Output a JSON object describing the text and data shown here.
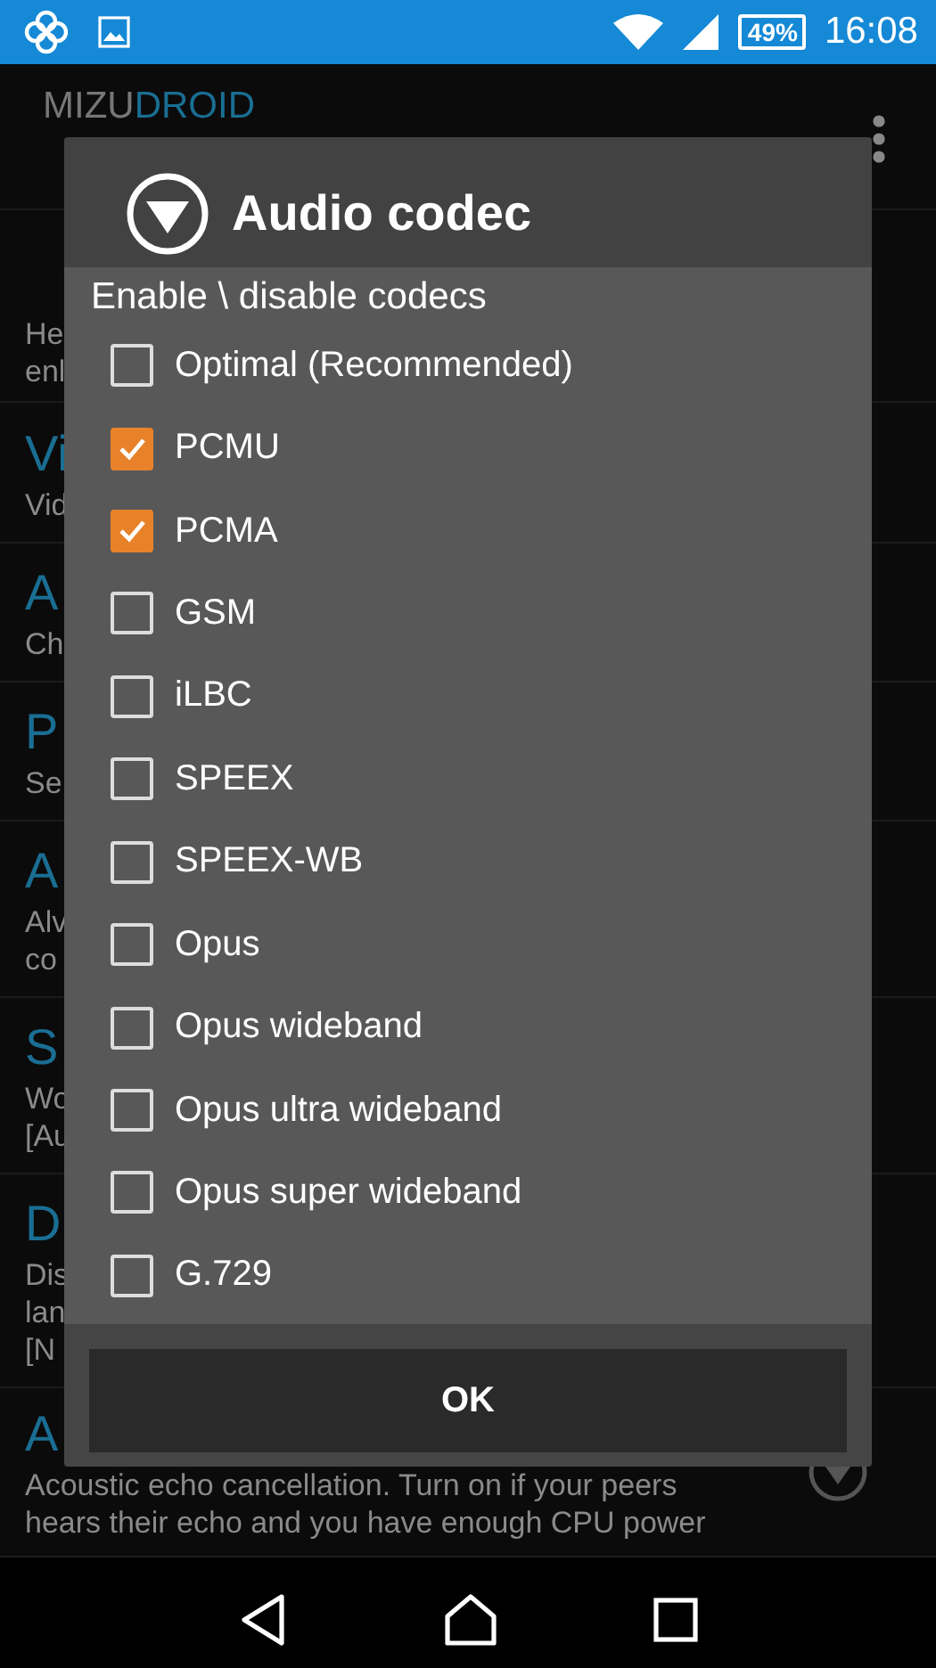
{
  "status_bar": {
    "battery": "49%",
    "time": "16:08"
  },
  "app_bar": {
    "brand": "MIZU",
    "brand_accent": "DROID"
  },
  "settings": [
    {
      "lines": [
        "He",
        "enl"
      ]
    },
    {
      "title": "Vi",
      "lines": [
        "Vid"
      ]
    },
    {
      "title": "A",
      "lines": [
        "Ch"
      ]
    },
    {
      "title": "P",
      "lines": [
        "Se"
      ]
    },
    {
      "title": "A",
      "lines": [
        "Alv",
        "co"
      ]
    },
    {
      "title": "S",
      "lines": [
        "Wo",
        "[Au"
      ]
    },
    {
      "title": "D",
      "lines": [
        "Dis",
        "lan",
        "[N"
      ]
    },
    {
      "title": "A",
      "lines": [
        "Acoustic echo cancellation. Turn on if your peers",
        "hears their echo and you have enough CPU power"
      ],
      "toggle": true
    }
  ],
  "dialog": {
    "title": "Audio codec",
    "subtitle": "Enable \\ disable codecs",
    "codecs": [
      {
        "label": "Optimal (Recommended)",
        "checked": false
      },
      {
        "label": "PCMU",
        "checked": true
      },
      {
        "label": "PCMA",
        "checked": true
      },
      {
        "label": "GSM",
        "checked": false
      },
      {
        "label": "iLBC",
        "checked": false
      },
      {
        "label": "SPEEX",
        "checked": false
      },
      {
        "label": "SPEEX-WB",
        "checked": false
      },
      {
        "label": "Opus",
        "checked": false
      },
      {
        "label": "Opus wideband",
        "checked": false
      },
      {
        "label": "Opus ultra wideband",
        "checked": false
      },
      {
        "label": "Opus super wideband",
        "checked": false
      },
      {
        "label": "G.729",
        "checked": false
      }
    ],
    "button": "OK"
  }
}
